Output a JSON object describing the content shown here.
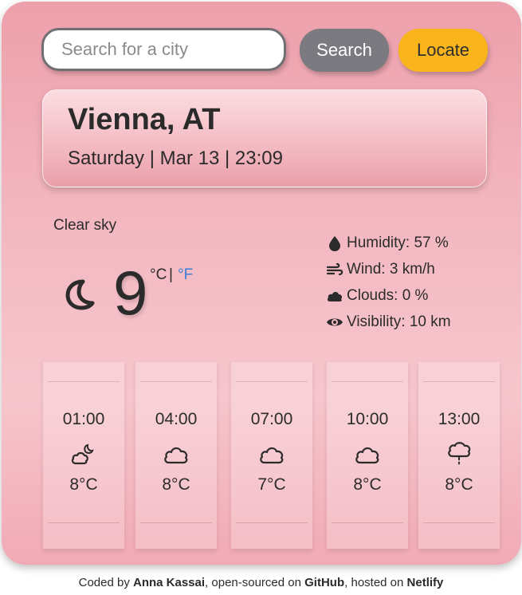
{
  "search": {
    "placeholder": "Search for a city",
    "value": ""
  },
  "buttons": {
    "search_label": "Search",
    "locate_label": "Locate"
  },
  "location": {
    "city": "Vienna, AT",
    "datetime": "Saturday | Mar 13 | 23:09"
  },
  "current": {
    "description": "Clear sky",
    "icon": "moon-icon",
    "temperature": "9",
    "unit_c": "°C",
    "unit_separator": "|",
    "unit_f": "°F"
  },
  "details": [
    {
      "icon": "droplet-icon",
      "text": "Humidity: 57 %"
    },
    {
      "icon": "wind-icon",
      "text": "Wind: 3 km/h"
    },
    {
      "icon": "cloud-icon",
      "text": "Clouds: 0 %"
    },
    {
      "icon": "eye-icon",
      "text": "Visibility: 10 km"
    }
  ],
  "forecast": [
    {
      "time": "01:00",
      "icon": "partly-cloudy-night-icon",
      "temp": "8°C"
    },
    {
      "time": "04:00",
      "icon": "cloud-icon",
      "temp": "8°C"
    },
    {
      "time": "07:00",
      "icon": "cloud-icon",
      "temp": "7°C"
    },
    {
      "time": "10:00",
      "icon": "cloud-icon",
      "temp": "8°C"
    },
    {
      "time": "13:00",
      "icon": "light-rain-icon",
      "temp": "8°C"
    }
  ],
  "footer": {
    "coded_by": "Coded by",
    "author": "Anna Kassai",
    "open_sourced": ", open-sourced on",
    "github": "GitHub",
    "hosted": ", hosted on",
    "netlify": "Netlify"
  },
  "colors": {
    "accent_blue": "#3a7fd5",
    "locate_button": "#fbb51c",
    "search_button": "#7a7a80",
    "card_pink": "#f3b8c1"
  }
}
